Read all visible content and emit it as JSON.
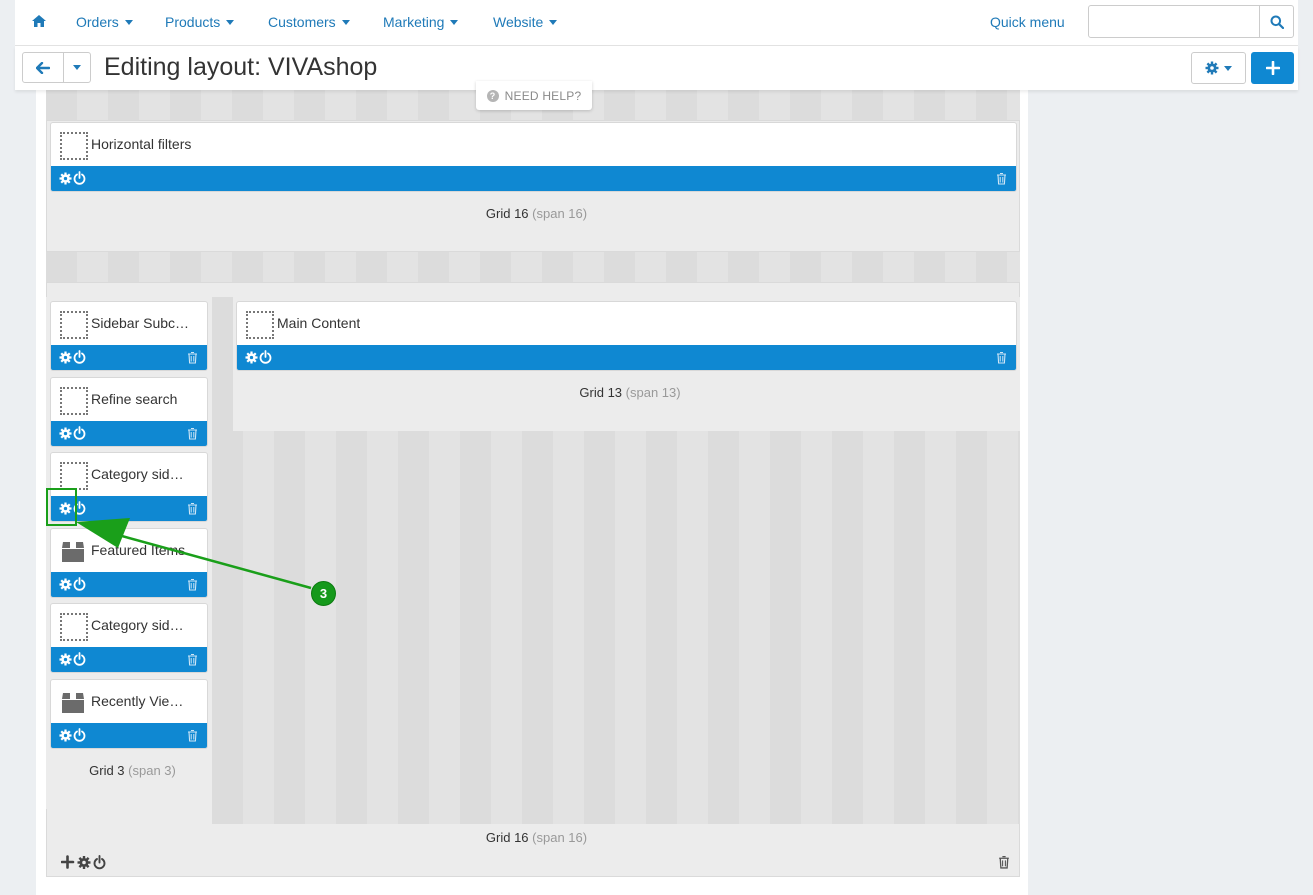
{
  "nav": {
    "items": [
      {
        "label": "Orders"
      },
      {
        "label": "Products"
      },
      {
        "label": "Customers"
      },
      {
        "label": "Marketing"
      },
      {
        "label": "Website"
      }
    ],
    "quick_menu": "Quick menu",
    "search": {
      "value": "",
      "placeholder": ""
    }
  },
  "header": {
    "title": "Editing layout: VIVAshop",
    "need_help": "NEED HELP?"
  },
  "grids": {
    "top": {
      "label": "Grid 16",
      "span": "(span 16)",
      "blocks": [
        {
          "name": "Horizontal filters",
          "icon": "dotted-box-icon"
        }
      ]
    },
    "sidebar": {
      "label": "Grid 3",
      "span": "(span 3)",
      "blocks": [
        {
          "name": "Sidebar Subc…",
          "icon": "dotted-box-icon"
        },
        {
          "name": "Refine search",
          "icon": "dotted-box-icon"
        },
        {
          "name": "Category sid…",
          "icon": "dotted-box-icon"
        },
        {
          "name": "Featured Items",
          "icon": "box-icon"
        },
        {
          "name": "Category sid…",
          "icon": "dotted-box-icon"
        },
        {
          "name": "Recently Vie…",
          "icon": "box-icon"
        }
      ]
    },
    "main": {
      "label": "Grid 13",
      "span": "(span 13)",
      "blocks": [
        {
          "name": "Main Content",
          "icon": "dotted-box-icon"
        }
      ]
    },
    "container": {
      "label": "Grid 16",
      "span": "(span 16)"
    }
  },
  "annotation": {
    "number": "3",
    "color": "#15991b"
  },
  "colors": {
    "accent": "#0f88d2",
    "link": "#1f7ab8",
    "highlight": "#1a9f1a"
  }
}
